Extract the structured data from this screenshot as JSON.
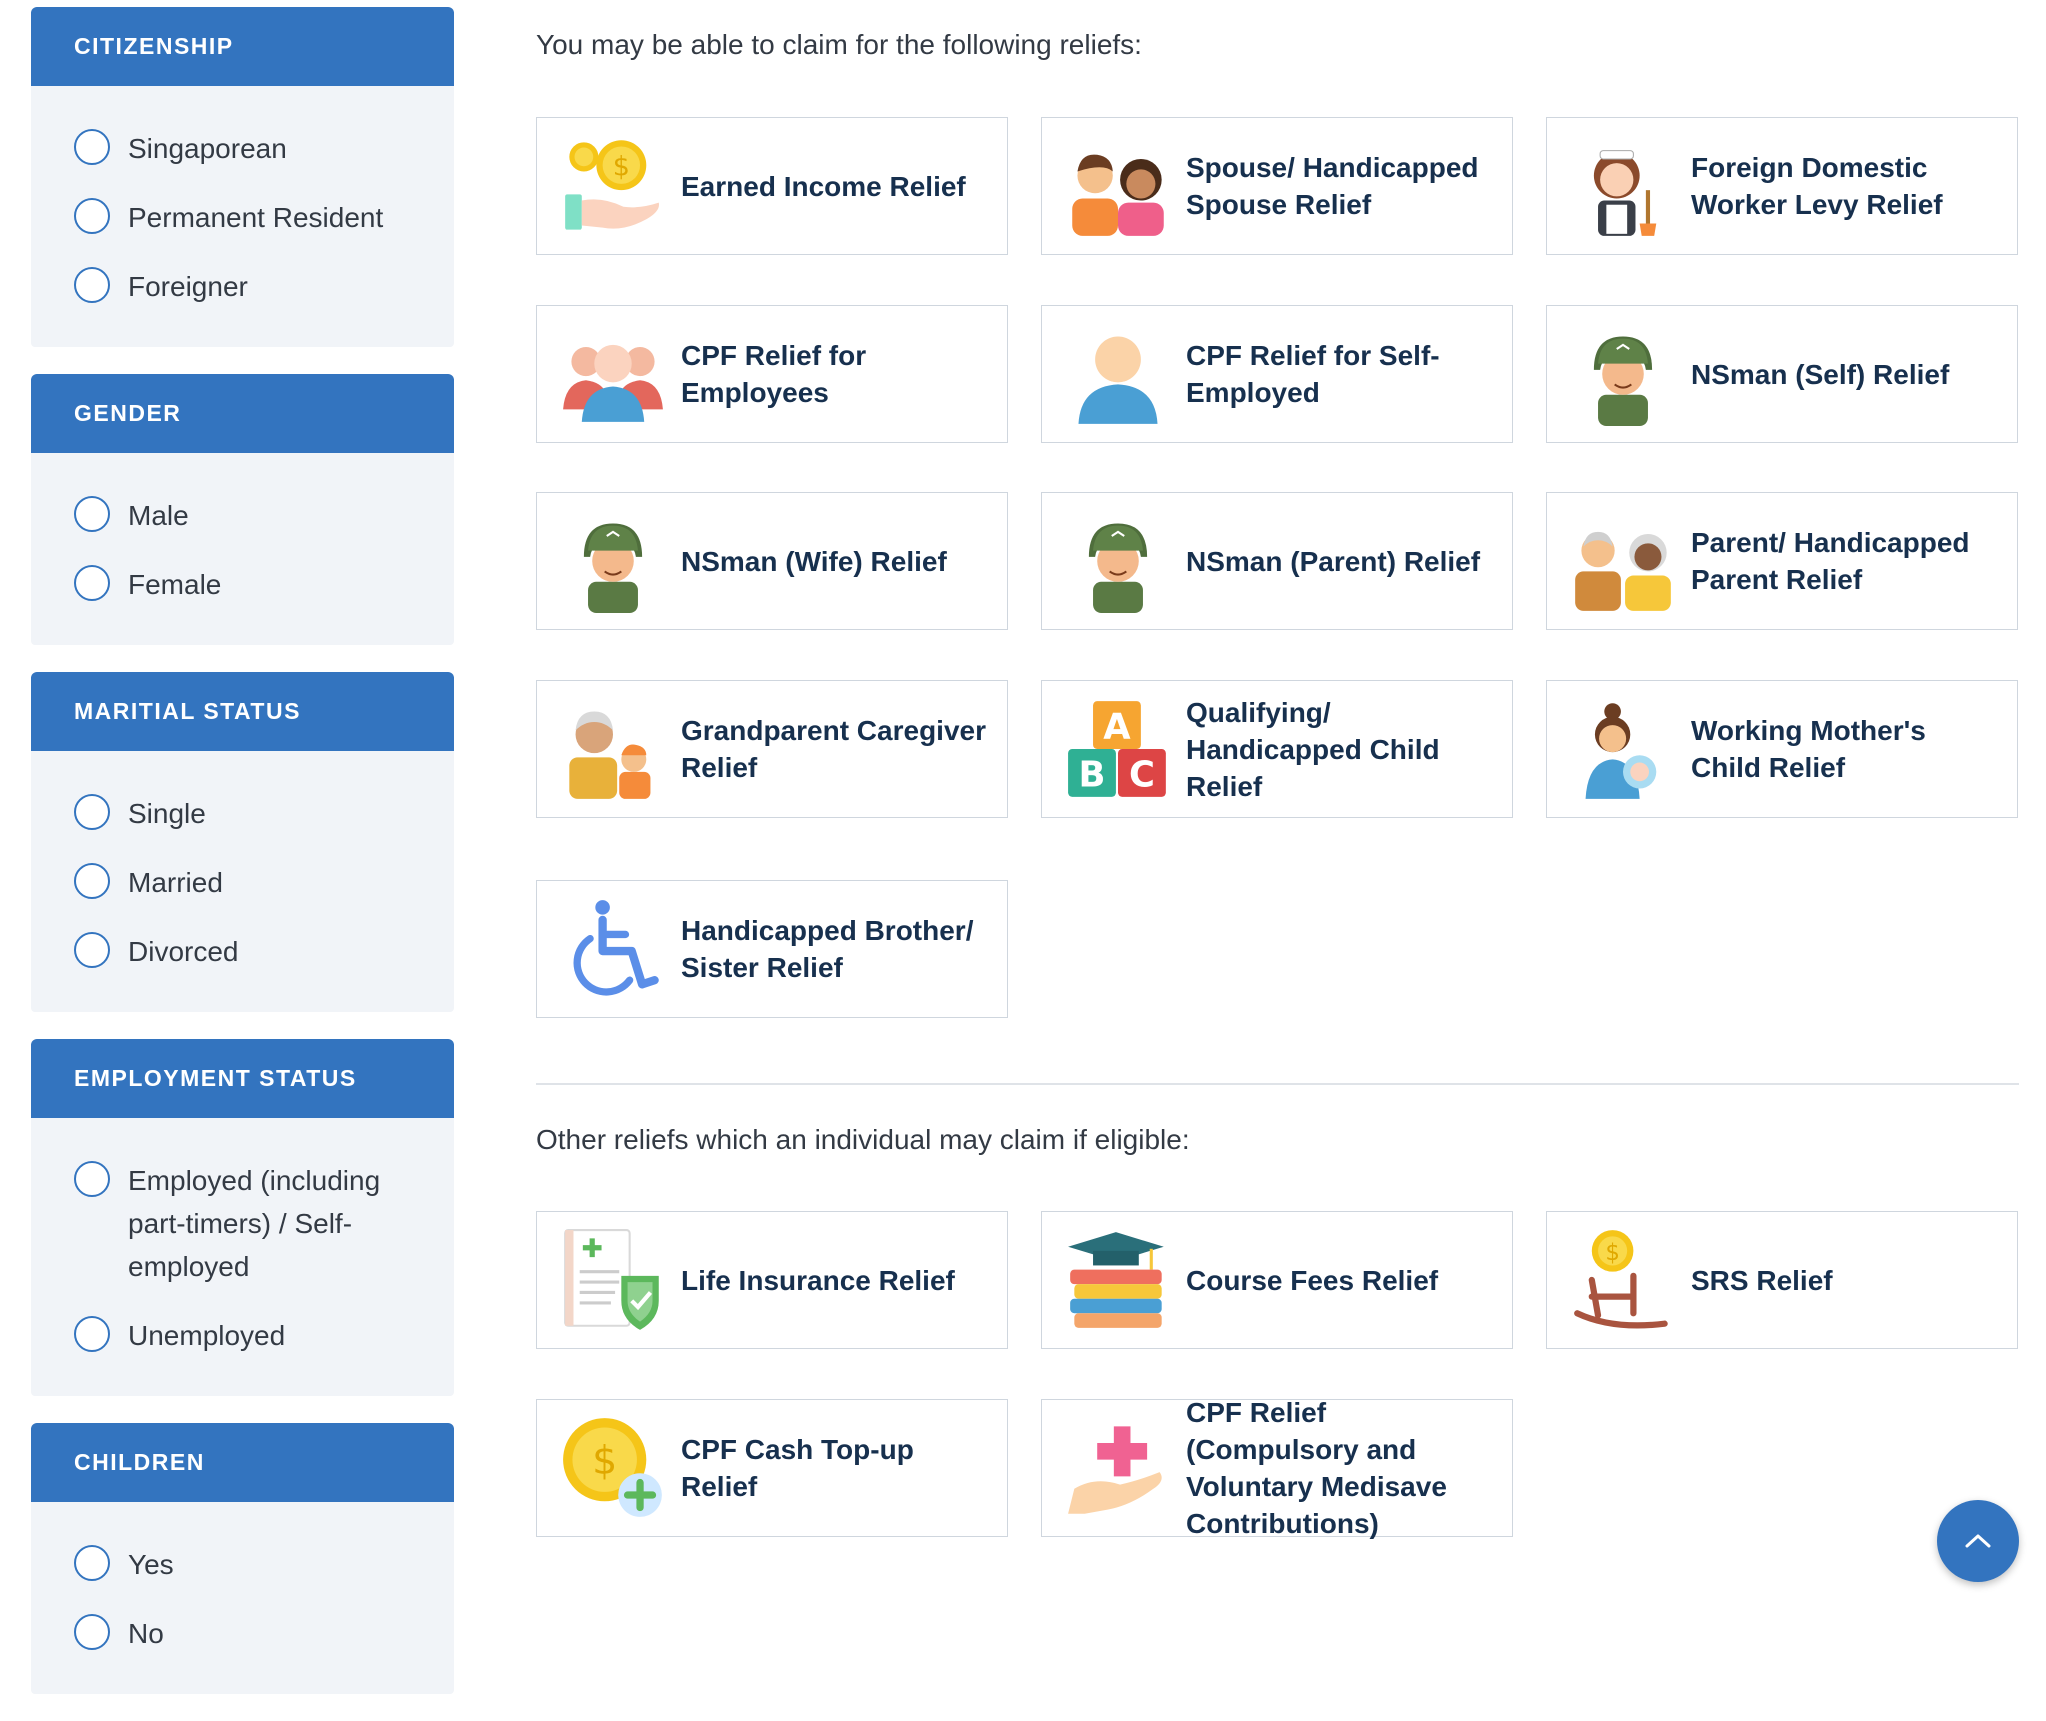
{
  "filters": {
    "citizenship": {
      "title": "CITIZENSHIP",
      "options": [
        "Singaporean",
        "Permanent Resident",
        "Foreigner"
      ]
    },
    "gender": {
      "title": "GENDER",
      "options": [
        "Male",
        "Female"
      ]
    },
    "marital": {
      "title": "MARITIAL STATUS",
      "options": [
        "Single",
        "Married",
        "Divorced"
      ]
    },
    "employment": {
      "title": "EMPLOYMENT STATUS",
      "options": [
        "Employed (including part-timers) / Self-employed",
        "Unemployed"
      ]
    },
    "children": {
      "title": "CHILDREN",
      "options": [
        "Yes",
        "No"
      ]
    }
  },
  "main": {
    "intro": "You may be able to claim for the following reliefs:",
    "reliefs": [
      {
        "label": "Earned Income Relief",
        "icon": "hand-coins-icon"
      },
      {
        "label": "Spouse/ Handicapped Spouse Relief",
        "icon": "couple-icon"
      },
      {
        "label": "Foreign Domestic Worker Levy Relief",
        "icon": "maid-icon"
      },
      {
        "label": "CPF Relief for Employees",
        "icon": "group-icon"
      },
      {
        "label": "CPF Relief for Self-Employed",
        "icon": "person-icon"
      },
      {
        "label": "NSman (Self) Relief",
        "icon": "soldier-icon"
      },
      {
        "label": "NSman (Wife) Relief",
        "icon": "soldier-icon"
      },
      {
        "label": "NSman (Parent) Relief",
        "icon": "soldier-icon"
      },
      {
        "label": "Parent/ Handicapped Parent Relief",
        "icon": "elderly-couple-icon"
      },
      {
        "label": "Grandparent Caregiver Relief",
        "icon": "grandparent-icon"
      },
      {
        "label": "Qualifying/ Handicapped Child Relief",
        "icon": "abc-blocks-icon"
      },
      {
        "label": "Working Mother's Child Relief",
        "icon": "mother-baby-icon"
      },
      {
        "label": "Handicapped Brother/ Sister Relief",
        "icon": "wheelchair-icon"
      }
    ],
    "other_intro": "Other reliefs which an individual may claim if eligible:",
    "other_reliefs": [
      {
        "label": "Life Insurance Relief",
        "icon": "insurance-doc-icon"
      },
      {
        "label": "Course Fees Relief",
        "icon": "books-cap-icon"
      },
      {
        "label": "SRS Relief",
        "icon": "rocking-chair-coin-icon"
      },
      {
        "label": "CPF Cash Top-up Relief",
        "icon": "coin-plus-icon"
      },
      {
        "label": "CPF Relief (Compulsory and Voluntary Medisave Contributions)",
        "icon": "medical-hand-icon"
      }
    ]
  },
  "colors": {
    "primary": "#3374bf",
    "panel_bg": "#f1f4f8",
    "card_text": "#17304e",
    "card_border": "#cfd6de"
  }
}
